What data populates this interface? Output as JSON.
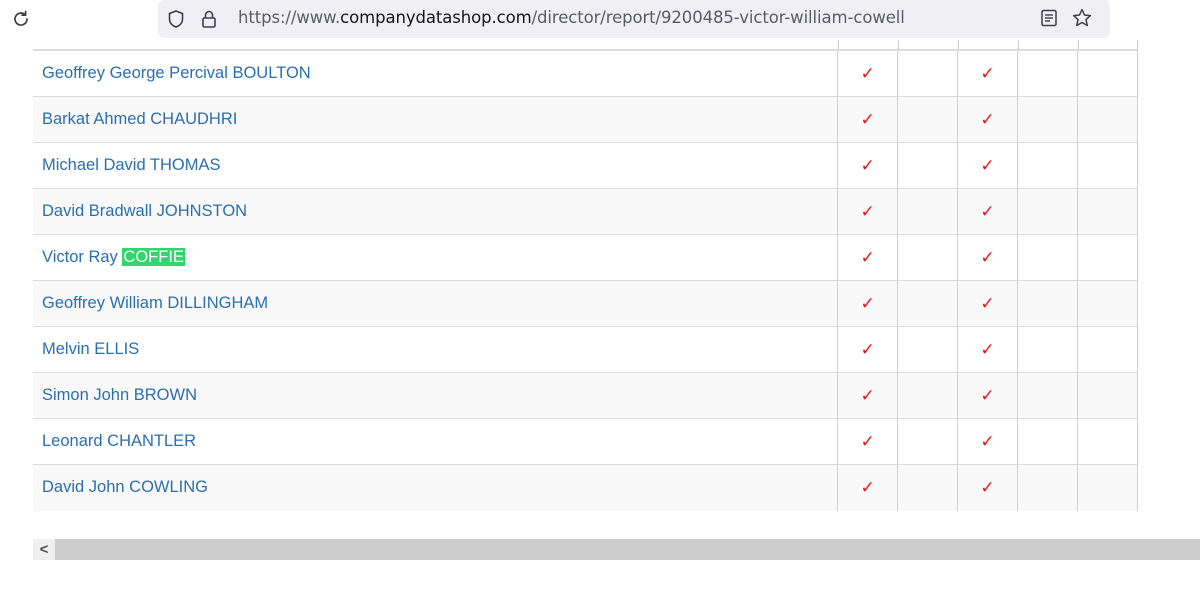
{
  "browser": {
    "url_prefix": "https://www.",
    "url_host": "companydatashop.com",
    "url_path": "/director/report/9200485-victor-william-cowell",
    "icons": [
      "reload-icon",
      "shield-icon",
      "lock-icon",
      "reader-view-icon",
      "bookmark-star-icon"
    ]
  },
  "colors": {
    "link": "#2a6fb0",
    "checkmark": "#e5141a",
    "highlight": "#2fd56d"
  },
  "directors": [
    {
      "first": "Geoffrey George Percival",
      "last": "BOULTON",
      "highlight": false,
      "col1": "✓",
      "col3": "✓"
    },
    {
      "first": "Barkat Ahmed",
      "last": "CHAUDHRI",
      "highlight": false,
      "col1": "✓",
      "col3": "✓"
    },
    {
      "first": "Michael David",
      "last": "THOMAS",
      "highlight": false,
      "col1": "✓",
      "col3": "✓"
    },
    {
      "first": "David Bradwall",
      "last": "JOHNSTON",
      "highlight": false,
      "col1": "✓",
      "col3": "✓"
    },
    {
      "first": "Victor Ray",
      "last": "COFFIE",
      "highlight": true,
      "col1": "✓",
      "col3": "✓"
    },
    {
      "first": "Geoffrey William",
      "last": "DILLINGHAM",
      "highlight": false,
      "col1": "✓",
      "col3": "✓"
    },
    {
      "first": "Melvin",
      "last": "ELLIS",
      "highlight": false,
      "col1": "✓",
      "col3": "✓"
    },
    {
      "first": "Simon John",
      "last": "BROWN",
      "highlight": false,
      "col1": "✓",
      "col3": "✓"
    },
    {
      "first": "Leonard",
      "last": "CHANTLER",
      "highlight": false,
      "col1": "✓",
      "col3": "✓"
    },
    {
      "first": "David John",
      "last": "COWLING",
      "highlight": false,
      "col1": "✓",
      "col3": "✓"
    }
  ],
  "scrollbar": {
    "left_arrow": "<"
  }
}
